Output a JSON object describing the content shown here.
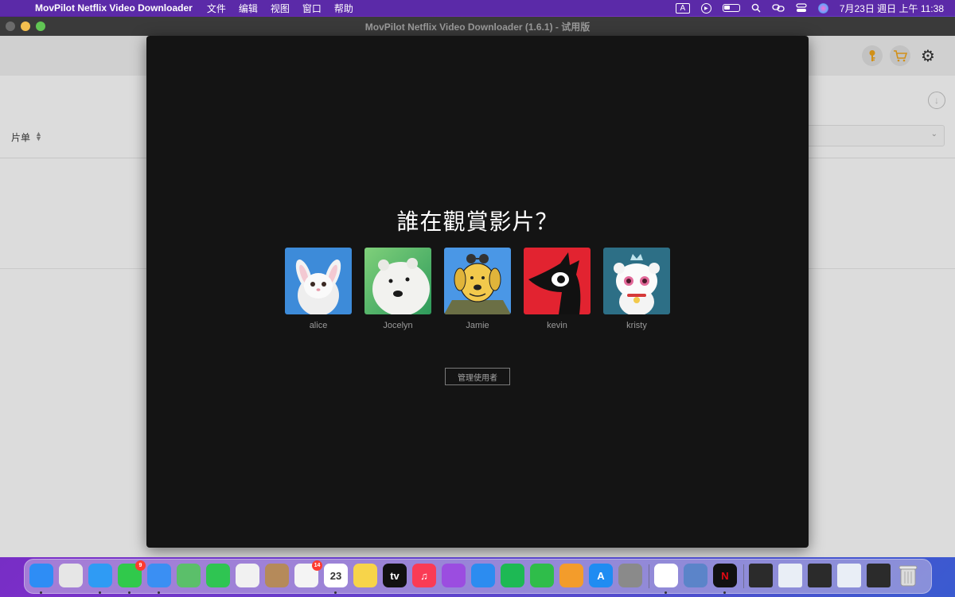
{
  "menubar": {
    "app_name": "MovPilot Netflix Video Downloader",
    "menus": [
      "文件",
      "编辑",
      "视图",
      "窗口",
      "帮助"
    ],
    "input_indicator": "A",
    "datetime": "7月23日 週日 上午 11:38"
  },
  "window": {
    "title": "MovPilot Netflix Video Downloader (1.6.1) - 试用版"
  },
  "toolbar": {
    "icons": [
      "key-icon",
      "cart-icon",
      "gear-icon"
    ]
  },
  "panel": {
    "sort_label": "片单"
  },
  "modal": {
    "title": "誰在觀賞影片？",
    "profiles": [
      {
        "name": "alice"
      },
      {
        "name": "Jocelyn"
      },
      {
        "name": "Jamie"
      },
      {
        "name": "kevin"
      },
      {
        "name": "kristy"
      }
    ],
    "manage_label": "管理使用者"
  },
  "dock": {
    "apps": [
      {
        "name": "finder",
        "color": "#2e8df5",
        "glyph": ""
      },
      {
        "name": "launchpad",
        "color": "#e6e6e6",
        "glyph": ""
      },
      {
        "name": "safari",
        "color": "#2f9bf4",
        "glyph": ""
      },
      {
        "name": "messages",
        "color": "#30c94b",
        "glyph": "",
        "badge": "9"
      },
      {
        "name": "mail",
        "color": "#3a8ff3",
        "glyph": ""
      },
      {
        "name": "maps",
        "color": "#5bbf6a",
        "glyph": ""
      },
      {
        "name": "facetime",
        "color": "#2fc552",
        "glyph": ""
      },
      {
        "name": "photos",
        "color": "#f1f1f1",
        "glyph": ""
      },
      {
        "name": "contacts",
        "color": "#b58a5a",
        "glyph": ""
      },
      {
        "name": "reminders",
        "color": "#f4f4f4",
        "glyph": "",
        "badge": "14"
      },
      {
        "name": "calendar",
        "color": "#ffffff",
        "glyph": "23"
      },
      {
        "name": "notes",
        "color": "#f7d44a",
        "glyph": ""
      },
      {
        "name": "apple-tv",
        "color": "#111111",
        "glyph": "tv"
      },
      {
        "name": "music",
        "color": "#fa3b55",
        "glyph": "♫"
      },
      {
        "name": "podcasts",
        "color": "#9b4de0",
        "glyph": ""
      },
      {
        "name": "keynote",
        "color": "#2c8cf0",
        "glyph": ""
      },
      {
        "name": "spotify",
        "color": "#1db954",
        "glyph": ""
      },
      {
        "name": "numbers",
        "color": "#2fbd4a",
        "glyph": ""
      },
      {
        "name": "pages",
        "color": "#f39c2b",
        "glyph": ""
      },
      {
        "name": "app-store",
        "color": "#1f8cf2",
        "glyph": "A"
      },
      {
        "name": "system-settings",
        "color": "#8a8a8a",
        "glyph": ""
      },
      {
        "name": "chrome",
        "color": "#ffffff",
        "glyph": ""
      },
      {
        "name": "preview",
        "color": "#5b84c9",
        "glyph": ""
      },
      {
        "name": "movpilot-netflix",
        "color": "#111111",
        "glyph": "N"
      }
    ]
  }
}
